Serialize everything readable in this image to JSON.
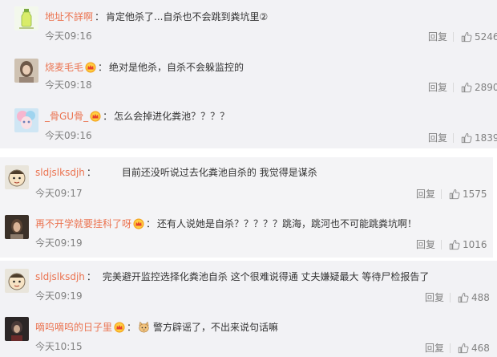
{
  "comments": [
    {
      "username": "地址不詳啊",
      "separator": "：",
      "text": "肯定他杀了...自杀也不会跳到粪坑里②",
      "time": "今天09:16",
      "reply": "回复",
      "likes": "5246",
      "avatar_icon": "bottle-avatar-icon",
      "vip": false
    },
    {
      "username": "烧麦毛毛",
      "separator": "：",
      "text": "绝对是他杀，自杀不会躲监控的",
      "time": "今天09:18",
      "reply": "回复",
      "likes": "2890",
      "avatar_icon": "girl-avatar-icon",
      "vip": true
    },
    {
      "username": "_骨GU骨_",
      "separator": "：",
      "text": "怎么会掉进化粪池？？？？",
      "time": "今天09:16",
      "reply": "回复",
      "likes": "1839",
      "avatar_icon": "anime-avatar-icon",
      "vip": true
    },
    {
      "username": "sldjslksdjh",
      "separator": "：",
      "text": "目前还没听说过去化粪池自杀的 我觉得是谋杀",
      "time": "今天09:17",
      "reply": "回复",
      "likes": "1575",
      "avatar_icon": "cartoon-face-avatar-icon",
      "vip": false
    },
    {
      "username": "再不开学就要挂科了呀",
      "separator": "：",
      "text": "还有人说她是自杀？？？？？跳海，跳河也不可能跳粪坑啊！",
      "time": "今天09:19",
      "reply": "回复",
      "likes": "1016",
      "avatar_icon": "photo-avatar-icon",
      "vip": true
    },
    {
      "username": "sldjslksdjh",
      "separator": "：",
      "text": "完美避开监控选择化粪池自杀 这个很难说得通 丈夫嫌疑最大 等待尸检报告了",
      "time": "今天09:19",
      "reply": "回复",
      "likes": "488",
      "avatar_icon": "cartoon-face-avatar-icon",
      "vip": false
    },
    {
      "username": "嘀呜嘀呜的日子里",
      "separator": "：",
      "text": "警方辟谣了，不出来说句话嘛",
      "time": "今天10:15",
      "reply": "回复",
      "likes": "468",
      "avatar_icon": "dark-avatar-icon",
      "vip": true,
      "emoji": "cat-emoji-icon"
    }
  ],
  "colors": {
    "username": "#eb7350",
    "meta": "#808080",
    "text": "#333333",
    "panel_bg": "#f2f2f5"
  },
  "icons": {
    "like": "thumbs-up-icon",
    "vip": "crown-badge-icon"
  }
}
